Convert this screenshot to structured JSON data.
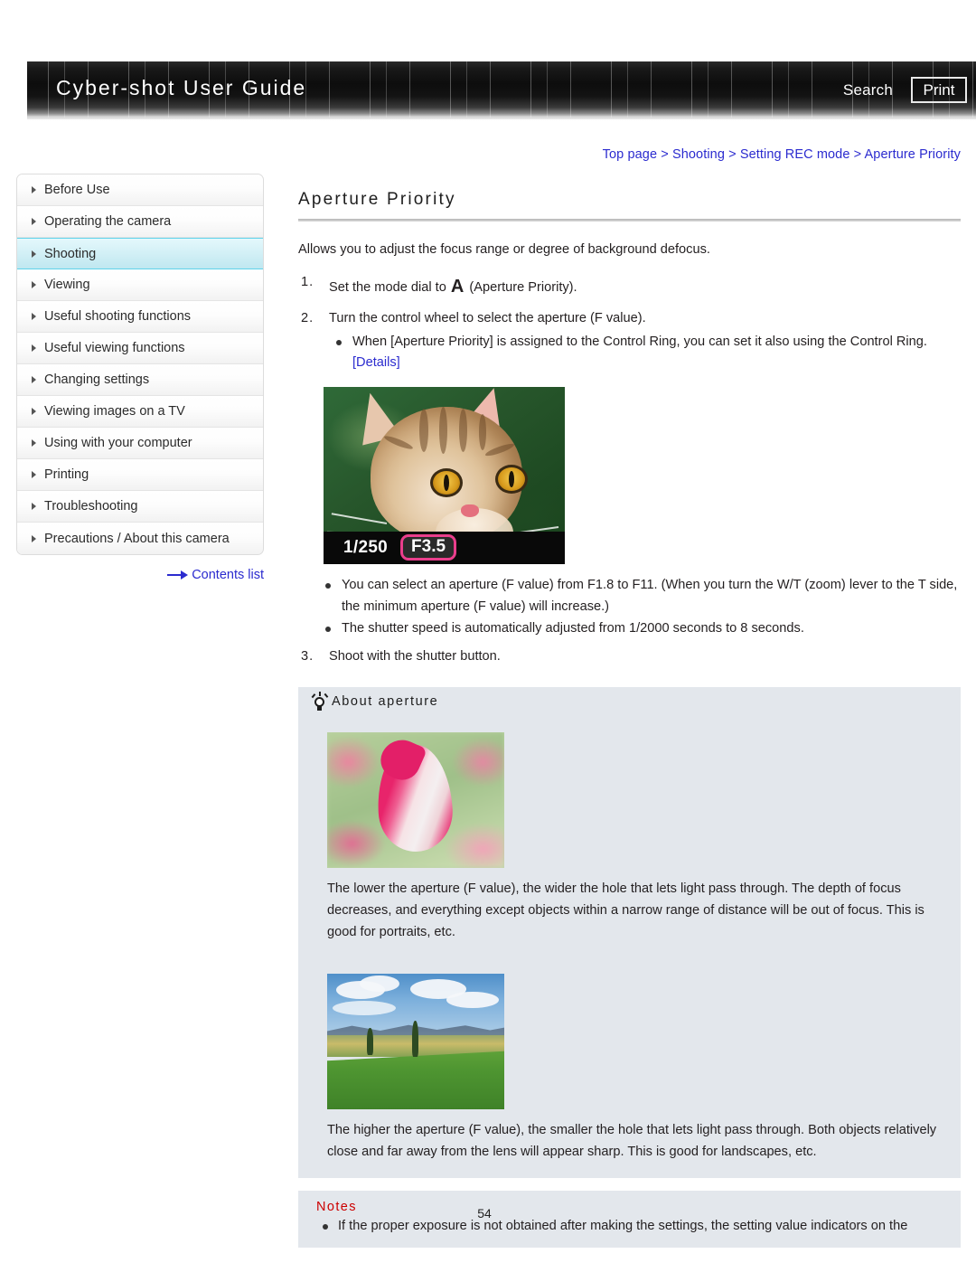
{
  "header": {
    "title": "Cyber-shot User Guide",
    "search_label": "Search",
    "print_label": "Print"
  },
  "breadcrumb": {
    "text": "Top page > Shooting > Setting REC mode > Aperture Priority"
  },
  "sidebar": {
    "items": [
      {
        "label": "Before Use",
        "active": false
      },
      {
        "label": "Operating the camera",
        "active": false
      },
      {
        "label": "Shooting",
        "active": true
      },
      {
        "label": "Viewing",
        "active": false
      },
      {
        "label": "Useful shooting functions",
        "active": false
      },
      {
        "label": "Useful viewing functions",
        "active": false
      },
      {
        "label": "Changing settings",
        "active": false
      },
      {
        "label": "Viewing images on a TV",
        "active": false
      },
      {
        "label": "Using with your computer",
        "active": false
      },
      {
        "label": "Printing",
        "active": false
      },
      {
        "label": "Troubleshooting",
        "active": false
      },
      {
        "label": "Precautions / About this camera",
        "active": false
      }
    ],
    "contents_link": "Contents list"
  },
  "main": {
    "title": "Aperture Priority",
    "intro": "Allows you to adjust the focus range or degree of background defocus.",
    "steps": [
      {
        "num": "1.",
        "text_before": "Set the mode dial to",
        "mode_symbol": "A",
        "text_after": "(Aperture Priority)."
      },
      {
        "num": "2.",
        "text": "Turn the control wheel to select the aperture (F value).",
        "subbullets": [
          {
            "text": "When [Aperture Priority] is assigned to the Control Ring, you can set it also using the Control Ring.",
            "link": "[Details]"
          }
        ]
      },
      {
        "num": "3.",
        "text": "Shoot with the shutter button."
      }
    ],
    "after_image_bullets": [
      "You can select an aperture (F value) from F1.8 to F11. (When you turn the W/T (zoom) lever to the T side, the minimum aperture (F value) will increase.)",
      "The shutter speed is automatically adjusted from 1/2000 seconds to 8 seconds."
    ],
    "camera_screen": {
      "shutter_speed": "1/250",
      "f_value": "F3.5",
      "highlight_color": "#ea3e8c",
      "subject": "cat-photo"
    }
  },
  "tip": {
    "title": "About aperture",
    "icon": "lightbulb-icon",
    "blocks": [
      {
        "image": "tulip-photo",
        "text": "The lower the aperture (F value), the wider the hole that lets light pass through. The depth of focus decreases, and everything except objects within a narrow range of distance will be out of focus. This is good for portraits, etc."
      },
      {
        "image": "landscape-photo",
        "text": "The higher the aperture (F value), the smaller the hole that lets light pass through. Both objects relatively close and far away from the lens will appear sharp. This is good for landscapes, etc."
      }
    ]
  },
  "notes": {
    "title": "Notes",
    "items": [
      "If the proper exposure is not obtained after making the settings, the setting value indicators on the"
    ]
  },
  "footer": {
    "page_number": "54"
  },
  "colors": {
    "link": "#2b2bcf",
    "notes_title": "#cc0000",
    "panel_bg": "#e3e7ec",
    "sidebar_active": "#bfe7f0",
    "sidebar_active_border": "#5fd3ea"
  }
}
